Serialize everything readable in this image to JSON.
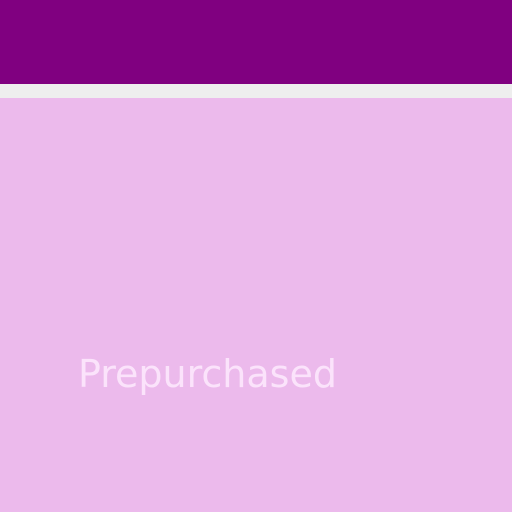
{
  "colors": {
    "top_bar": "#800080",
    "divider": "#eeeeee",
    "content_background": "#ecbaec",
    "label_text": "#fbe3fb"
  },
  "content": {
    "status_label": "Prepurchased"
  }
}
